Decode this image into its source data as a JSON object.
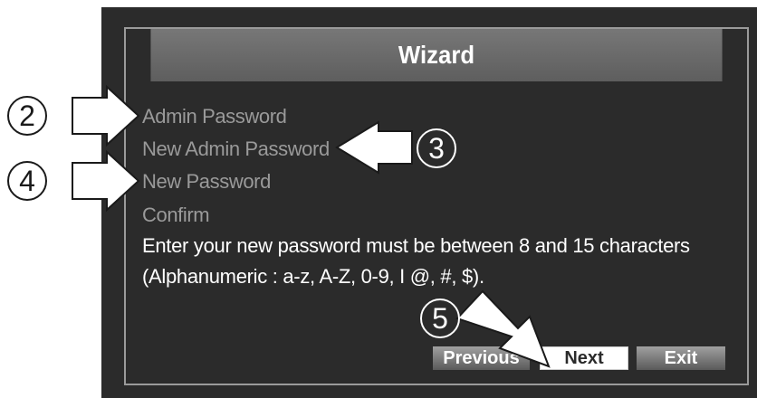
{
  "dialog": {
    "title": "Wizard",
    "menu": [
      {
        "label": "Admin Password"
      },
      {
        "label": "New Admin Password"
      },
      {
        "label": "New Password"
      },
      {
        "label": "Confirm"
      }
    ],
    "instruction_line1": "Enter your new password must be between 8 and 15 characters",
    "instruction_line2": "(Alphanumeric : a-z, A-Z, 0-9, I @, #, $).",
    "buttons": {
      "previous": "Previous",
      "next": "Next",
      "exit": "Exit"
    }
  },
  "callouts": {
    "c2": "2",
    "c3": "3",
    "c4": "4",
    "c5": "5"
  },
  "colors": {
    "screen_bg": "#2b2b2b",
    "menu_text": "#9a9a9a",
    "title_bar": "#6a6a6a"
  }
}
